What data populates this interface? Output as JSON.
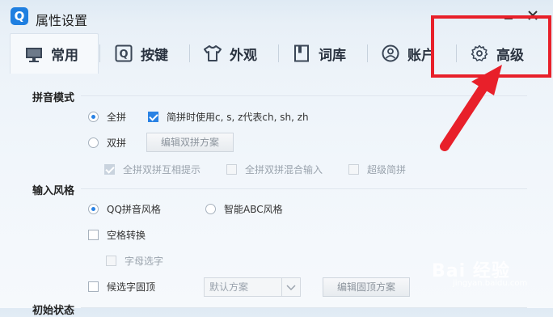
{
  "window": {
    "title": "属性设置",
    "logo_letter": "Q"
  },
  "tabs": [
    {
      "label": "常用",
      "icon": "monitor-icon",
      "active": true
    },
    {
      "label": "按键",
      "icon": "q-key-icon",
      "active": false
    },
    {
      "label": "外观",
      "icon": "tshirt-icon",
      "active": false
    },
    {
      "label": "词库",
      "icon": "book-icon",
      "active": false
    },
    {
      "label": "账户",
      "icon": "user-icon",
      "active": false
    },
    {
      "label": "高级",
      "icon": "gear-icon",
      "active": false
    }
  ],
  "pinyin": {
    "title": "拼音模式",
    "full": "全拼",
    "abbr_check": "简拼时使用c, s, z代表ch, sh, zh",
    "double": "双拼",
    "edit_double_btn": "编辑双拼方案",
    "hint": "全拼双拼互相提示",
    "mixed": "全拼双拼混合输入",
    "super": "超级简拼"
  },
  "style": {
    "title": "输入风格",
    "qq": "QQ拼音风格",
    "abc": "智能ABC风格",
    "space": "空格转换",
    "letter": "字母选字",
    "fixed": "候选字固顶",
    "select_value": "默认方案",
    "edit_fixed_btn": "编辑固顶方案"
  },
  "init": {
    "title": "初始状态"
  },
  "watermark": {
    "main": "Bai 经验",
    "sub": "jingyan.baidu.com"
  }
}
